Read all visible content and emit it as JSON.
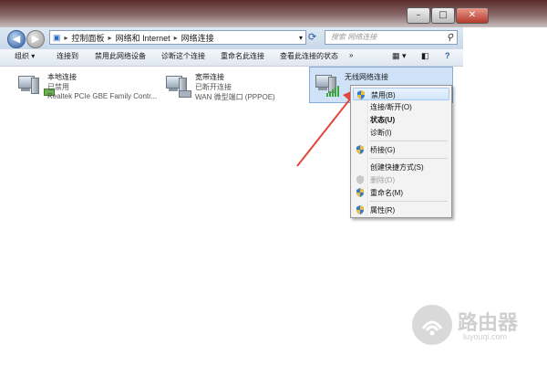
{
  "address": {
    "crumbs": [
      "控制面板",
      "网络和 Internet",
      "网络连接"
    ]
  },
  "search": {
    "placeholder": "搜索 网络连接"
  },
  "toolbar": {
    "items": [
      "组织 ▾",
      "连接到",
      "禁用此网络设备",
      "诊断这个连接",
      "重命名此连接",
      "查看此连接的状态",
      "»"
    ]
  },
  "connections": [
    {
      "name": "本地连接",
      "status": "已禁用",
      "device": "Realtek PCIe GBE Family Contr..."
    },
    {
      "name": "宽带连接",
      "status": "已断开连接",
      "device": "WAN 微型端口 (PPPOE)"
    },
    {
      "name": "无线网络连接"
    }
  ],
  "context_menu": {
    "items": [
      {
        "label": "禁用(B)",
        "shield": true,
        "highlighted": true
      },
      {
        "label": "连接/断开(O)",
        "shield": false
      },
      {
        "label": "状态(U)",
        "shield": false,
        "bold": true
      },
      {
        "label": "诊断(I)",
        "shield": false
      },
      {
        "label": "桥接(G)",
        "shield": true
      },
      {
        "label": "创建快捷方式(S)",
        "shield": false
      },
      {
        "label": "删除(D)",
        "shield": true,
        "disabled": true
      },
      {
        "label": "重命名(M)",
        "shield": true
      },
      {
        "label": "属性(R)",
        "shield": true
      }
    ]
  },
  "watermark": {
    "text": "路由器",
    "sub": "luyouqi.com"
  },
  "colors": {
    "arrow": "#e2453c",
    "selection": "#cfe2f7",
    "menu_bg": "#f3f3f3"
  }
}
